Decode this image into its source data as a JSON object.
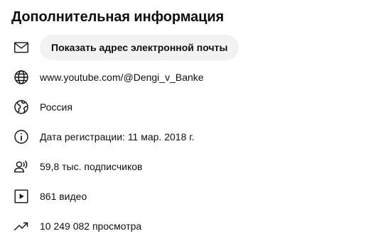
{
  "section_title": "Дополнительная информация",
  "email": {
    "icon": "mail-icon",
    "button_label": "Показать адрес электронной почты"
  },
  "website": {
    "icon": "globe-icon",
    "text": "www.youtube.com/@Dengi_v_Banke"
  },
  "country": {
    "icon": "earth-region-icon",
    "text": "Россия"
  },
  "joined": {
    "icon": "info-icon",
    "text": "Дата регистрации: 11 мар. 2018 г."
  },
  "subscribers": {
    "icon": "subscribers-icon",
    "text": "59,8 тыс. подписчиков"
  },
  "videos": {
    "icon": "video-play-icon",
    "text": "861 видео"
  },
  "views": {
    "icon": "trending-up-icon",
    "text": "10 249 082 просмотра"
  }
}
